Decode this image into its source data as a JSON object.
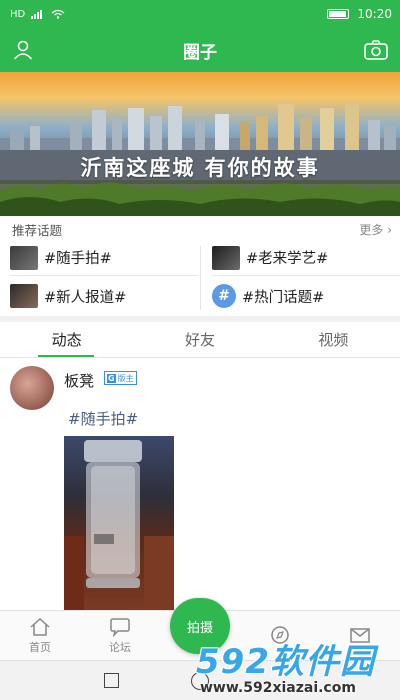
{
  "status_bar": {
    "time": "10:20",
    "network": "HD"
  },
  "app_bar": {
    "title": "圈子",
    "left_icon": "user-icon",
    "right_icon": "camera-icon"
  },
  "banner": {
    "caption": "沂南这座城   有你的故事"
  },
  "recommended": {
    "header": "推荐话题",
    "more": "更多",
    "topics": [
      {
        "label": "#随手拍#",
        "icon": "thumbnail"
      },
      {
        "label": "#老来学艺#",
        "icon": "thumbnail"
      },
      {
        "label": "#新人报道#",
        "icon": "thumbnail"
      },
      {
        "label": "#热门话题#",
        "icon": "hash-icon"
      }
    ]
  },
  "tabs": [
    {
      "label": "动态",
      "active": true
    },
    {
      "label": "好友",
      "active": false
    },
    {
      "label": "视频",
      "active": false
    }
  ],
  "post": {
    "username": "板凳",
    "badge_prefix": "G",
    "badge": "版主",
    "tag": "#随手拍#"
  },
  "bottom_nav": {
    "items": [
      {
        "label": "首页",
        "icon": "home-icon"
      },
      {
        "label": "论坛",
        "icon": "chat-icon"
      },
      {
        "label": "",
        "icon": "compass-icon"
      },
      {
        "label": "",
        "icon": "mail-icon"
      }
    ],
    "fab_label": "拍摄"
  },
  "watermark": {
    "brand": "592软件园",
    "url": "www.592xiazai.com"
  },
  "colors": {
    "primary": "#2fb84f",
    "link": "#4d5e80",
    "badge": "#3a8ee6"
  }
}
